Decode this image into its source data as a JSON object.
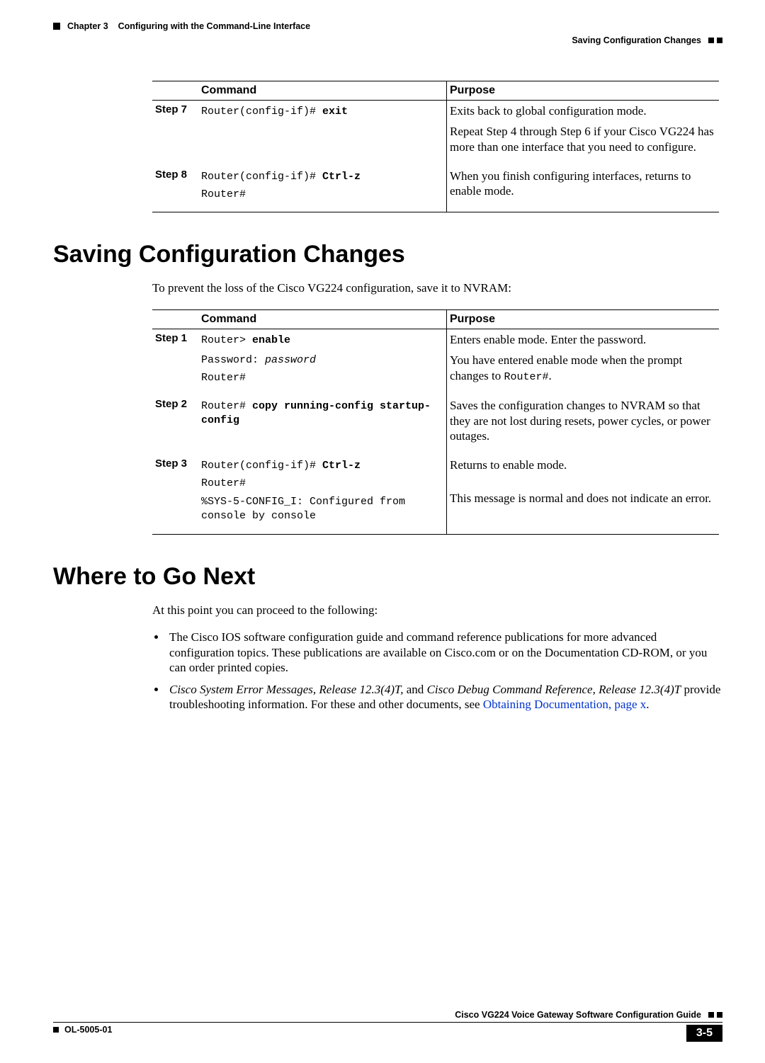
{
  "header": {
    "chapter": "Chapter 3",
    "chapter_title": "Configuring with the Command-Line Interface",
    "section_running": "Saving Configuration Changes"
  },
  "table1": {
    "headers": {
      "command": "Command",
      "purpose": "Purpose"
    },
    "rows": [
      {
        "step": "Step 7",
        "cmd_prefix": "Router(config-if)# ",
        "cmd_bold": "exit",
        "purpose1": "Exits back to global configuration mode.",
        "purpose2": "Repeat Step 4 through Step 6 if your Cisco VG224 has more than one interface that you need to configure."
      },
      {
        "step": "Step 8",
        "cmd_prefix": "Router(config-if)# ",
        "cmd_bold": "Ctrl-z",
        "cmd_line2": "Router#",
        "purpose1": "When you finish configuring interfaces, returns to enable mode."
      }
    ]
  },
  "section1": {
    "title": "Saving Configuration Changes",
    "intro": "To prevent the loss of the Cisco VG224 configuration, save it to NVRAM:"
  },
  "table2": {
    "headers": {
      "command": "Command",
      "purpose": "Purpose"
    },
    "rows": [
      {
        "step": "Step 1",
        "cmd_prefix": "Router> ",
        "cmd_bold": "enable",
        "cmd_line2_pre": "Password: ",
        "cmd_line2_ital": "password",
        "cmd_line3": "Router#",
        "purpose1": "Enters enable mode. Enter the password.",
        "purpose2_pre": "You have entered enable mode when the prompt changes to ",
        "purpose2_mono": "Router#",
        "purpose2_post": "."
      },
      {
        "step": "Step 2",
        "cmd_prefix": "Router# ",
        "cmd_bold": "copy running-config startup-config",
        "purpose1": "Saves the configuration changes to NVRAM so that they are not lost during resets, power cycles, or power outages."
      },
      {
        "step": "Step 3",
        "cmd_prefix": "Router(config-if)# ",
        "cmd_bold": "Ctrl-z",
        "cmd_line2": "Router#",
        "cmd_line3": "%SYS-5-CONFIG_I: Configured from console by console",
        "purpose1": "Returns to enable mode.",
        "purpose2": "This message is normal and does not indicate an error."
      }
    ]
  },
  "section2": {
    "title": "Where to Go Next",
    "intro": "At this point you can proceed to the following:",
    "bullet1": "The Cisco IOS software configuration guide and command reference publications for more advanced configuration topics. These publications are available on Cisco.com or on the Documentation CD-ROM, or you can order printed copies.",
    "bullet2_ital1": "Cisco System Error Messages, Release 12.3(4)T,",
    "bullet2_mid": " and ",
    "bullet2_ital2": "Cisco Debug Command Reference, Release 12.3(4)T",
    "bullet2_rest": " provide troubleshooting information. For these and other documents, see ",
    "bullet2_link": "Obtaining Documentation, page x",
    "bullet2_end": "."
  },
  "footer": {
    "doc_title": "Cisco VG224 Voice Gateway Software Configuration Guide",
    "doc_id": "OL-5005-01",
    "page": "3-5"
  }
}
